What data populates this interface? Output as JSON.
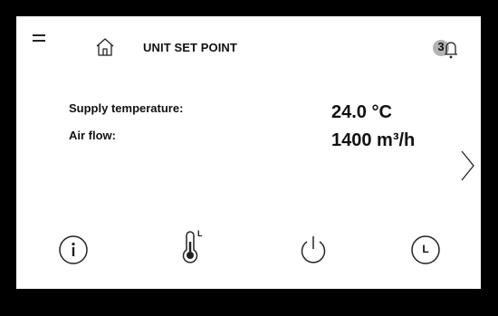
{
  "header": {
    "title": "UNIT SET POINT",
    "notification_count": "3",
    "icons": [
      "menu-icon",
      "home-icon",
      "bell-icon"
    ]
  },
  "readings": [
    {
      "label": "Supply temperature:",
      "value": "24.0 °C"
    },
    {
      "label": "Air flow:",
      "value": "1400 m³/h"
    }
  ],
  "navigation": {
    "next_icon": "chevron-right-icon"
  },
  "bottom_bar": {
    "icons": [
      "info-icon",
      "thermometer-low-icon",
      "power-icon",
      "clock-icon"
    ],
    "thermometer_mark": "L",
    "clock_mark": "L"
  },
  "colors": {
    "bezel": "#000000",
    "screen": "#ffffff",
    "text": "#111111",
    "badge": "#b3b3b3"
  }
}
